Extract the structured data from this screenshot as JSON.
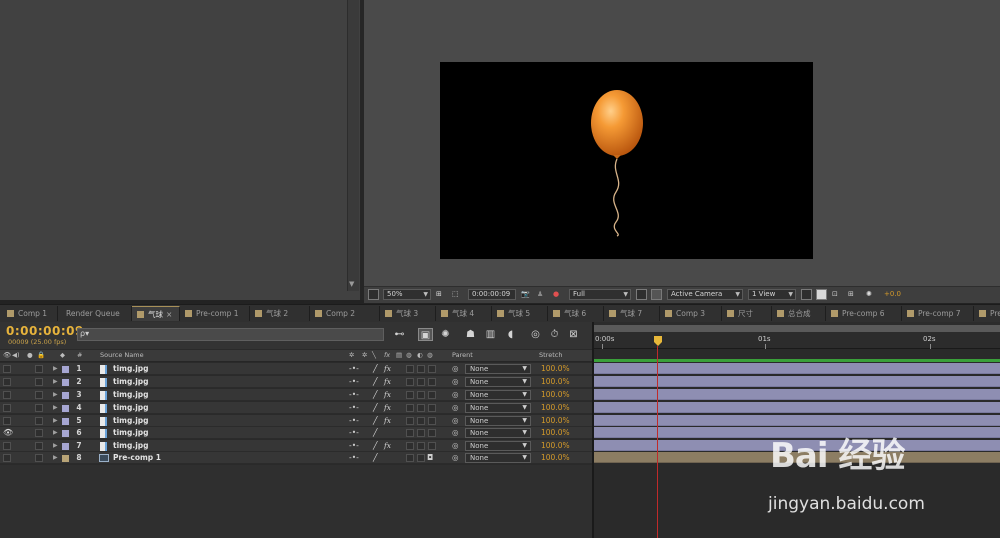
{
  "viewer_toolbar": {
    "zoom": "50%",
    "timecode": "0:00:00:09",
    "resolution": "Full",
    "camera": "Active Camera",
    "view": "1 View",
    "exposure": "+0.0"
  },
  "tabs": [
    {
      "label": "Comp 1"
    },
    {
      "label": "Render Queue"
    },
    {
      "label": "气球"
    },
    {
      "label": "Pre-comp 1"
    },
    {
      "label": "气球 2"
    },
    {
      "label": "Comp 2"
    },
    {
      "label": "气球 3"
    },
    {
      "label": "气球 4"
    },
    {
      "label": "气球 5"
    },
    {
      "label": "气球 6"
    },
    {
      "label": "气球 7"
    },
    {
      "label": "Comp 3"
    },
    {
      "label": "尺寸"
    },
    {
      "label": "总合成"
    },
    {
      "label": "Pre-comp 6"
    },
    {
      "label": "Pre-comp 7"
    },
    {
      "label": "Pre"
    }
  ],
  "timeline": {
    "timecode": "0:00:00:09",
    "frames_fps": "00009 (25.00 fps)",
    "search_placeholder": "ρ▾",
    "columns": {
      "number": "#",
      "source_name": "Source Name",
      "parent": "Parent",
      "stretch": "Stretch"
    },
    "ruler": {
      "start": "0:00s",
      "mark1": "01s",
      "mark2": "02s"
    },
    "layers": [
      {
        "num": "1",
        "name": "timg.jpg",
        "parent": "None",
        "stretch": "100.0%"
      },
      {
        "num": "2",
        "name": "timg.jpg",
        "parent": "None",
        "stretch": "100.0%"
      },
      {
        "num": "3",
        "name": "timg.jpg",
        "parent": "None",
        "stretch": "100.0%"
      },
      {
        "num": "4",
        "name": "timg.jpg",
        "parent": "None",
        "stretch": "100.0%"
      },
      {
        "num": "5",
        "name": "timg.jpg",
        "parent": "None",
        "stretch": "100.0%"
      },
      {
        "num": "6",
        "name": "timg.jpg",
        "parent": "None",
        "stretch": "100.0%"
      },
      {
        "num": "7",
        "name": "timg.jpg",
        "parent": "None",
        "stretch": "100.0%"
      },
      {
        "num": "8",
        "name": "Pre-comp 1",
        "parent": "None",
        "stretch": "100.0%"
      }
    ]
  },
  "watermark": {
    "logo": "Bai 经验",
    "url": "jingyan.baidu.com"
  },
  "colors": {
    "timecode": "#e6b33c",
    "label_purple": "#a6a6d2",
    "label_tan": "#b8a477",
    "layer_bar": "#8e8eb2",
    "precomp_bar": "#8c7d63",
    "current_time_line": "#c02a2a",
    "balloon": "#f0922c"
  }
}
